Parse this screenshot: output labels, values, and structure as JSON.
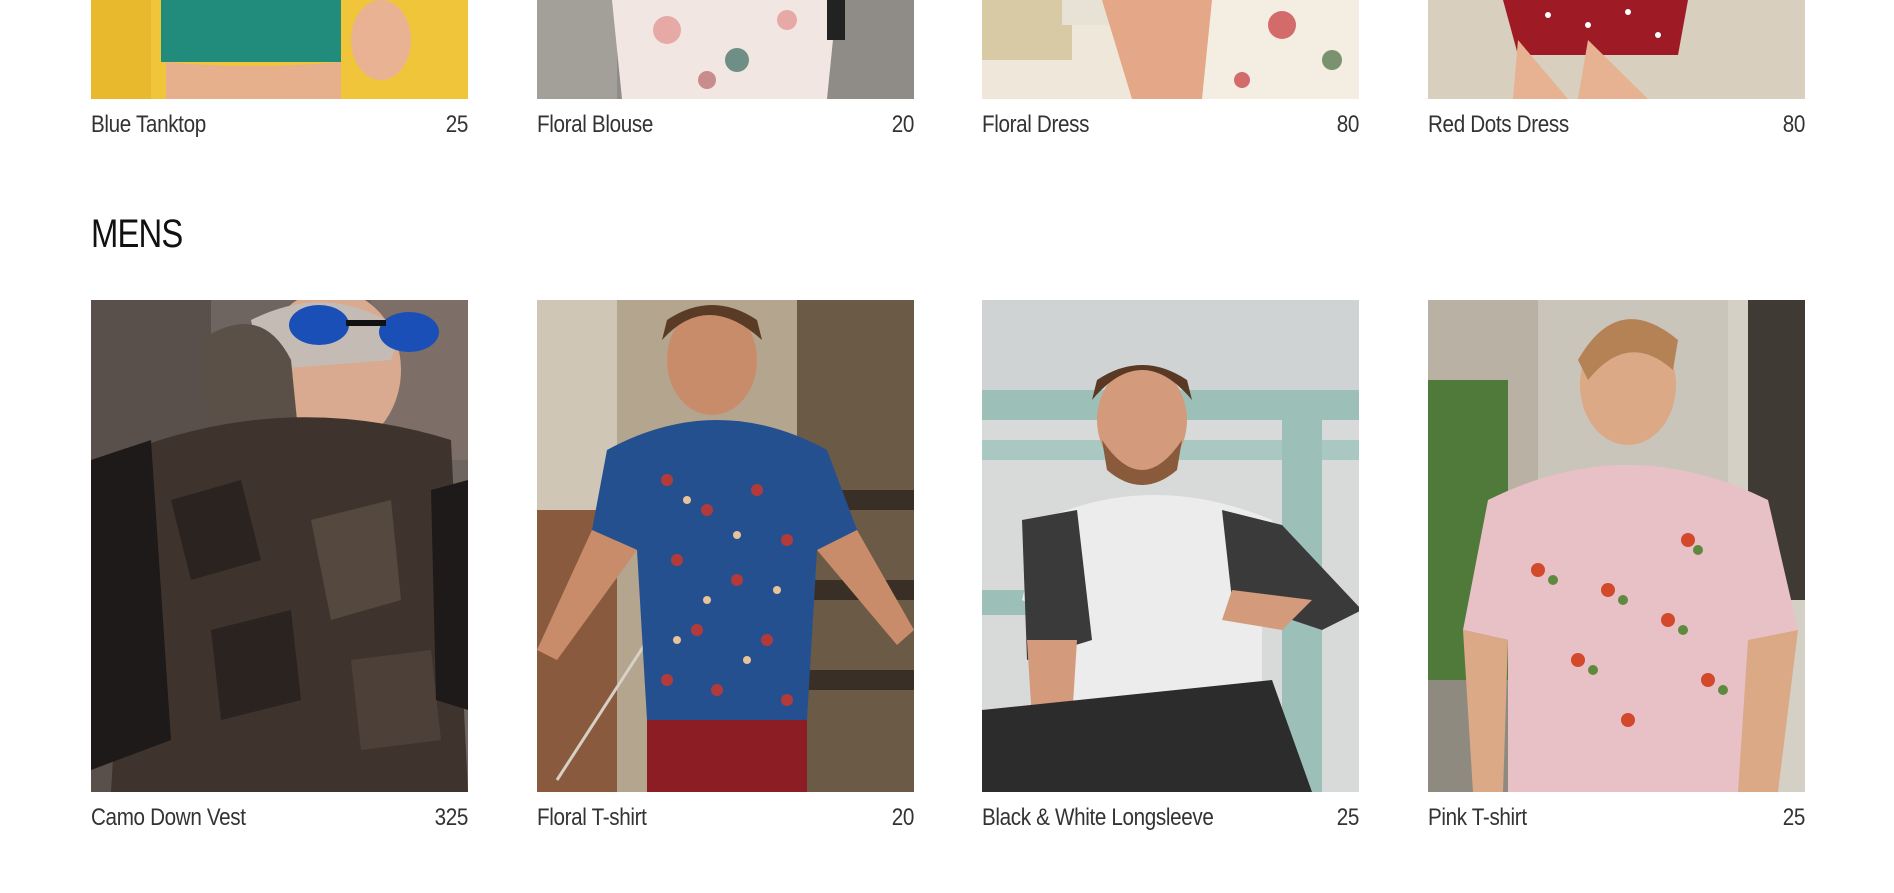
{
  "womens_products": [
    {
      "name": "Blue Tanktop",
      "price": "25",
      "image": "blue-tanktop-photo"
    },
    {
      "name": "Floral Blouse",
      "price": "20",
      "image": "floral-blouse-photo"
    },
    {
      "name": "Floral Dress",
      "price": "80",
      "image": "floral-dress-photo"
    },
    {
      "name": "Red Dots Dress",
      "price": "80",
      "image": "red-dots-dress-photo"
    }
  ],
  "mens_section": {
    "title": "MENS",
    "products": [
      {
        "name": "Camo Down Vest",
        "price": "325",
        "image": "camo-down-vest-photo"
      },
      {
        "name": "Floral T-shirt",
        "price": "20",
        "image": "floral-tshirt-photo"
      },
      {
        "name": "Black & White Longsleeve",
        "price": "25",
        "image": "black-white-longsleeve-photo"
      },
      {
        "name": "Pink T-shirt",
        "price": "25",
        "image": "pink-tshirt-photo"
      }
    ]
  },
  "colors": {
    "background": "#ffffff",
    "text": "#333333",
    "heading": "#111111"
  }
}
